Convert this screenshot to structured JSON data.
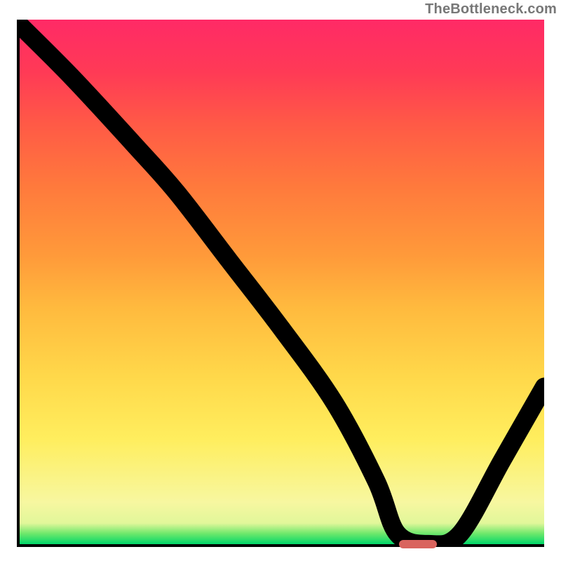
{
  "watermark": "TheBottleneck.com",
  "chart_data": {
    "type": "line",
    "title": "",
    "xlabel": "",
    "ylabel": "",
    "xlim": [
      0,
      100
    ],
    "ylim": [
      0,
      100
    ],
    "x": [
      0,
      10,
      22,
      30,
      40,
      50,
      60,
      68,
      72,
      78,
      84,
      92,
      100
    ],
    "values": [
      99,
      89,
      76,
      67,
      54,
      41,
      27,
      12,
      2,
      0,
      2,
      16,
      30
    ],
    "optimum_marker_x": 76,
    "gradient_note": "background is qualitative zone heatmap (green good -> red bad), not a data series"
  },
  "axes": {
    "left": true,
    "bottom": true,
    "ticks": false,
    "labels": false
  }
}
